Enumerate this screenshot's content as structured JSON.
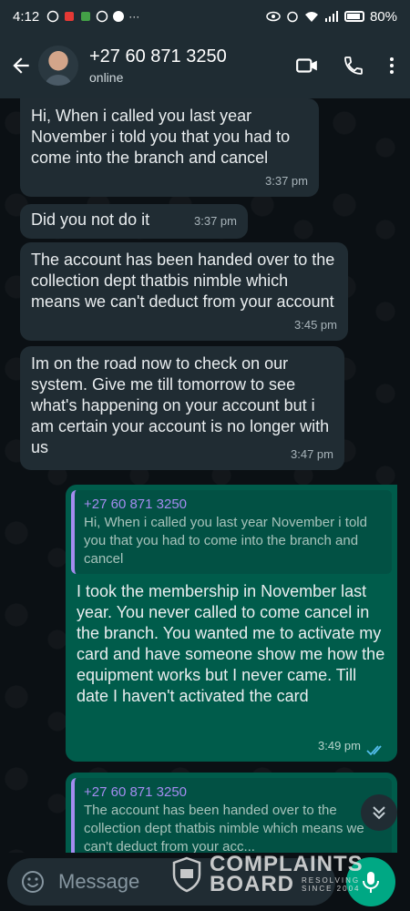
{
  "status_bar": {
    "time": "4:12",
    "battery": "80%"
  },
  "header": {
    "contact_name": "+27 60 871 3250",
    "contact_status": "online"
  },
  "messages": [
    {
      "direction": "in",
      "text": "Hi, When i called you last year November i told you that you had to come into the branch and cancel",
      "time": "3:37 pm"
    },
    {
      "direction": "in",
      "text": "Did you not do it",
      "time": "3:37 pm"
    },
    {
      "direction": "in",
      "text": "The account has been handed over to the collection dept thatbis nimble which means we can't deduct from your account",
      "time": "3:45 pm"
    },
    {
      "direction": "in",
      "text": "Im on the road now to check on our system. Give me till tomorrow to see what's happening on your account but i am certain your account is no longer with us",
      "time": "3:47 pm"
    },
    {
      "direction": "out",
      "quote_name": "+27 60 871 3250",
      "quote_text": "Hi, When i called you last year November i told you that you had to come into the branch and cancel",
      "text": "I took the membership in November last year. You never called to come cancel in the branch. You wanted me to activate my card and have someone show me how the equipment works but I never came. Till date I haven't activated the card",
      "time": "3:49 pm"
    },
    {
      "direction": "out",
      "quote_name": "+27 60 871 3250",
      "quote_text": "The account has been handed over to the collection dept thatbis nimble which means we can't deduct from your acc..."
    }
  ],
  "composer": {
    "placeholder": "Message"
  },
  "watermark": {
    "line1": "COMPLAINTS",
    "line2": "BOARD",
    "line3": "RESOLVING",
    "line4": "SINCE 2004"
  },
  "colors": {
    "incoming_bubble": "#202c33",
    "outgoing_bubble": "#005c4b",
    "accent": "#00a884",
    "quote_accent": "#a48cf0",
    "read_ticks": "#53bdeb"
  }
}
